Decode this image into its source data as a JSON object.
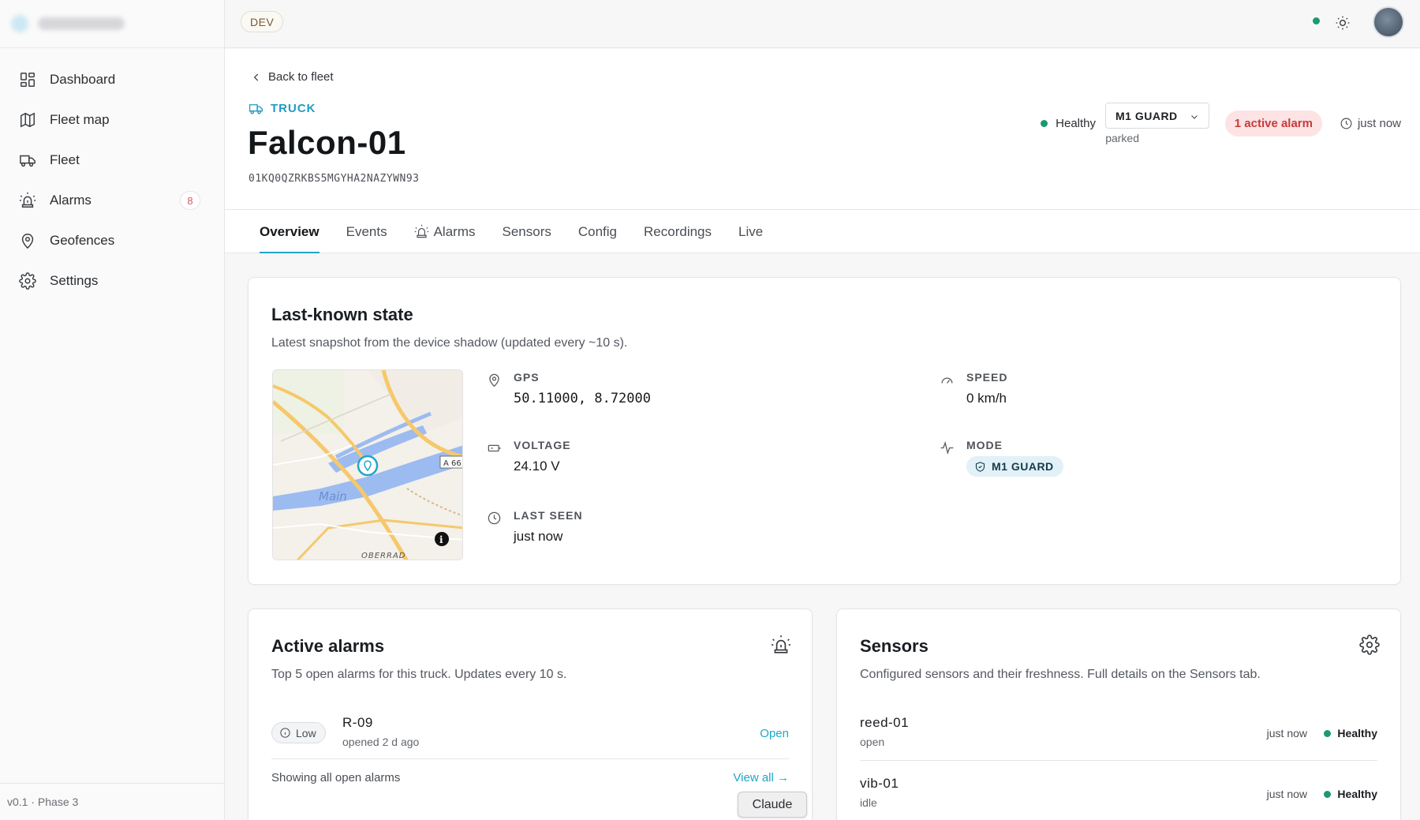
{
  "sidebar": {
    "items": [
      {
        "label": "Dashboard",
        "icon": "dashboard-icon"
      },
      {
        "label": "Fleet map",
        "icon": "map-icon"
      },
      {
        "label": "Fleet",
        "icon": "truck-icon"
      },
      {
        "label": "Alarms",
        "icon": "siren-icon",
        "badge": "8"
      },
      {
        "label": "Geofences",
        "icon": "pin-icon"
      },
      {
        "label": "Settings",
        "icon": "gear-icon"
      }
    ],
    "footer": "v0.1 · Phase 3"
  },
  "topbar": {
    "env": "DEV",
    "status_color": "#1c9a6c"
  },
  "header": {
    "back_label": "Back to fleet",
    "type_label": "TRUCK",
    "title": "Falcon-01",
    "device_id": "01KQ0QZRKBS5MGYHA2NAZYWN93",
    "health": "Healthy",
    "mode": "M1 GUARD",
    "mode_sub": "parked",
    "alarm_pill": "1 active alarm",
    "last_update": "just now"
  },
  "tabs": [
    {
      "label": "Overview",
      "active": true
    },
    {
      "label": "Events"
    },
    {
      "label": "Alarms",
      "icon": "siren-icon"
    },
    {
      "label": "Sensors"
    },
    {
      "label": "Config"
    },
    {
      "label": "Recordings"
    },
    {
      "label": "Live"
    }
  ],
  "state_card": {
    "title": "Last-known state",
    "subtitle": "Latest snapshot from the device shadow (updated every ~10 s).",
    "map": {
      "river_label": "Main",
      "district_label": "OBERRAD",
      "road_label": "A 66"
    },
    "gps": {
      "label": "GPS",
      "value": "50.11000, 8.72000"
    },
    "speed": {
      "label": "SPEED",
      "value": "0 km/h"
    },
    "voltage": {
      "label": "VOLTAGE",
      "value": "24.10 V"
    },
    "mode": {
      "label": "MODE",
      "value": "M1 GUARD"
    },
    "last_seen": {
      "label": "LAST SEEN",
      "value": "just now"
    }
  },
  "alarms_card": {
    "title": "Active alarms",
    "subtitle": "Top 5 open alarms for this truck. Updates every 10 s.",
    "rows": [
      {
        "severity": "Low",
        "id": "R-09",
        "opened": "opened 2 d ago",
        "status": "Open"
      }
    ],
    "footer": "Showing all open alarms",
    "view_all": "View all →"
  },
  "sensors_card": {
    "title": "Sensors",
    "subtitle": "Configured sensors and their freshness. Full details on the Sensors tab.",
    "rows": [
      {
        "name": "reed-01",
        "state": "open",
        "time": "just now",
        "health": "Healthy"
      },
      {
        "name": "vib-01",
        "state": "idle",
        "time": "just now",
        "health": "Healthy"
      }
    ]
  },
  "tooltip": "Claude"
}
